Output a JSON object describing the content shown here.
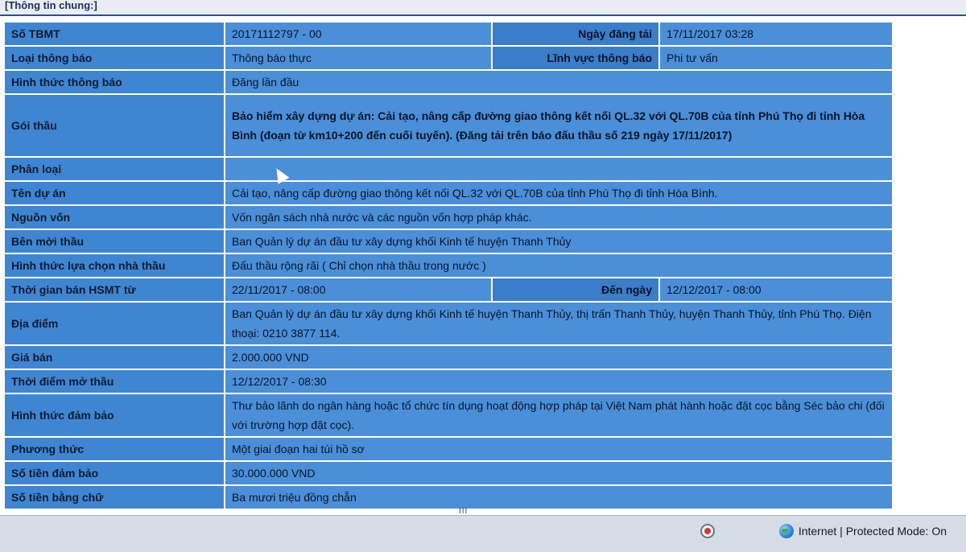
{
  "section_title": "[Thông tin chung:]",
  "rows": {
    "so_tbmt": {
      "label": "Số TBMT",
      "value": "20171112797   -   00",
      "label2": "Ngày đăng tải",
      "value2": "17/11/2017 03:28"
    },
    "loai_thong_bao": {
      "label": "Loại thông báo",
      "value": "Thông báo thực",
      "label2": "Lĩnh vực thông báo",
      "value2": "Phi tư vấn"
    },
    "hinh_thuc_thong_bao": {
      "label": "Hình thức thông báo",
      "value": "Đăng lần đầu"
    },
    "goi_thau": {
      "label": "Gói thầu",
      "value": "Bảo hiểm xây dựng dự án: Cải tạo, nâng cấp đường giao thông kết nối QL.32 với QL.70B của tỉnh Phú Thọ đi tỉnh Hòa Bình (đoạn từ km10+200 đến cuối tuyến). (Đăng tải trên báo đấu thầu số 219 ngày 17/11/2017)"
    },
    "phan_loai": {
      "label": "Phân loại",
      "value": ""
    },
    "ten_du_an": {
      "label": "Tên dự án",
      "value": "Cải tạo, nâng cấp đường giao thông kết nối QL.32 với QL.70B của tỉnh Phú Thọ đi tỉnh Hòa Bình."
    },
    "nguon_von": {
      "label": "Nguồn vốn",
      "value": "Vốn ngân sách nhà nước và các nguồn vốn hợp pháp khác."
    },
    "ben_moi_thau": {
      "label": "Bên mời thầu",
      "value": "Ban Quản lý dự án đầu tư xây dựng khối Kinh tế huyện Thanh Thủy"
    },
    "hinh_thuc_lua_chon": {
      "label": "Hình thức lựa chọn nhà thầu",
      "value": "Đấu thầu rộng rãi ( Chỉ chọn nhà thầu trong nước )"
    },
    "thoi_gian_ban": {
      "label": "Thời gian bán HSMT từ",
      "value": "22/11/2017 - 08:00",
      "label2": "Đến ngày",
      "value2": "12/12/2017 - 08:00"
    },
    "dia_diem": {
      "label": "Địa điểm",
      "value": "Ban Quản lý dự án đầu tư xây dựng khối Kinh tế huyện Thanh Thủy, thị trấn Thanh Thủy, huyện Thanh Thủy, tỉnh Phú Thọ. Điện thoại: 0210 3877 114."
    },
    "gia_ban": {
      "label": "Giá bán",
      "value": "2.000.000 VND"
    },
    "thoi_diem_mo_thau": {
      "label": "Thời điểm mở thầu",
      "value": "12/12/2017 - 08:30"
    },
    "hinh_thuc_dam_bao": {
      "label": "Hình thức đảm bảo",
      "value": "Thư bảo lãnh do ngân hàng hoặc tổ chức tín dụng hoạt động hợp pháp tại Việt Nam phát hành hoặc đặt cọc bằng Séc bảo chi (đối với trường hợp đặt cọc)."
    },
    "phuong_thuc": {
      "label": "Phương thức",
      "value": "Một giai đoạn hai túi hồ sơ"
    },
    "so_tien_dam_bao": {
      "label": "Số tiền đảm bảo",
      "value": "30.000.000 VND"
    },
    "so_tien_bang_chu": {
      "label": "Số tiền bằng chữ",
      "value": "Ba mươi triệu đồng chẵn"
    }
  },
  "scroll_grip": "III",
  "status": {
    "zone_text": "Internet | Protected Mode: On",
    "zone_icon": "globe-icon",
    "protected_icon": "protected-mode-icon"
  }
}
